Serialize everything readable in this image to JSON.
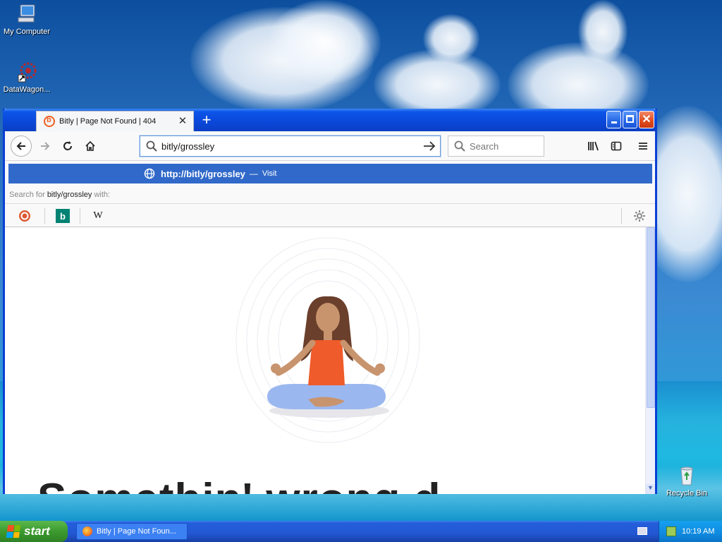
{
  "desktop": {
    "icons": [
      {
        "label": "My Computer"
      },
      {
        "label": "DataWagon..."
      },
      {
        "label": "Recycle Bin"
      }
    ]
  },
  "browser": {
    "tab_title": "Bitly | Page Not Found | 404",
    "new_tab_label": "+",
    "url_text": "bitly/grossley",
    "search_placeholder": "Search",
    "suggestion": {
      "url_prefix": "http://",
      "url_bold": "bitly/grossley",
      "dash": "—",
      "action": "Visit"
    },
    "search_with": {
      "prefix": "Search for ",
      "query": "bitly/grossley",
      "suffix": " with:"
    },
    "engines": [
      {
        "name": "duckduckgo-icon"
      },
      {
        "name": "bing-icon",
        "glyph": "b"
      },
      {
        "name": "wikipedia-icon",
        "glyph": "W"
      }
    ],
    "page_heading_fragment": "Somethin' wrong d"
  },
  "taskbar": {
    "start_label": "start",
    "task_label": "Bitly | Page Not Foun...",
    "clock": "10:19 AM"
  },
  "colors": {
    "titlebar": "#0a47d8",
    "suggestion_highlight": "#3069c9",
    "bitly_orange": "#ee6123"
  }
}
